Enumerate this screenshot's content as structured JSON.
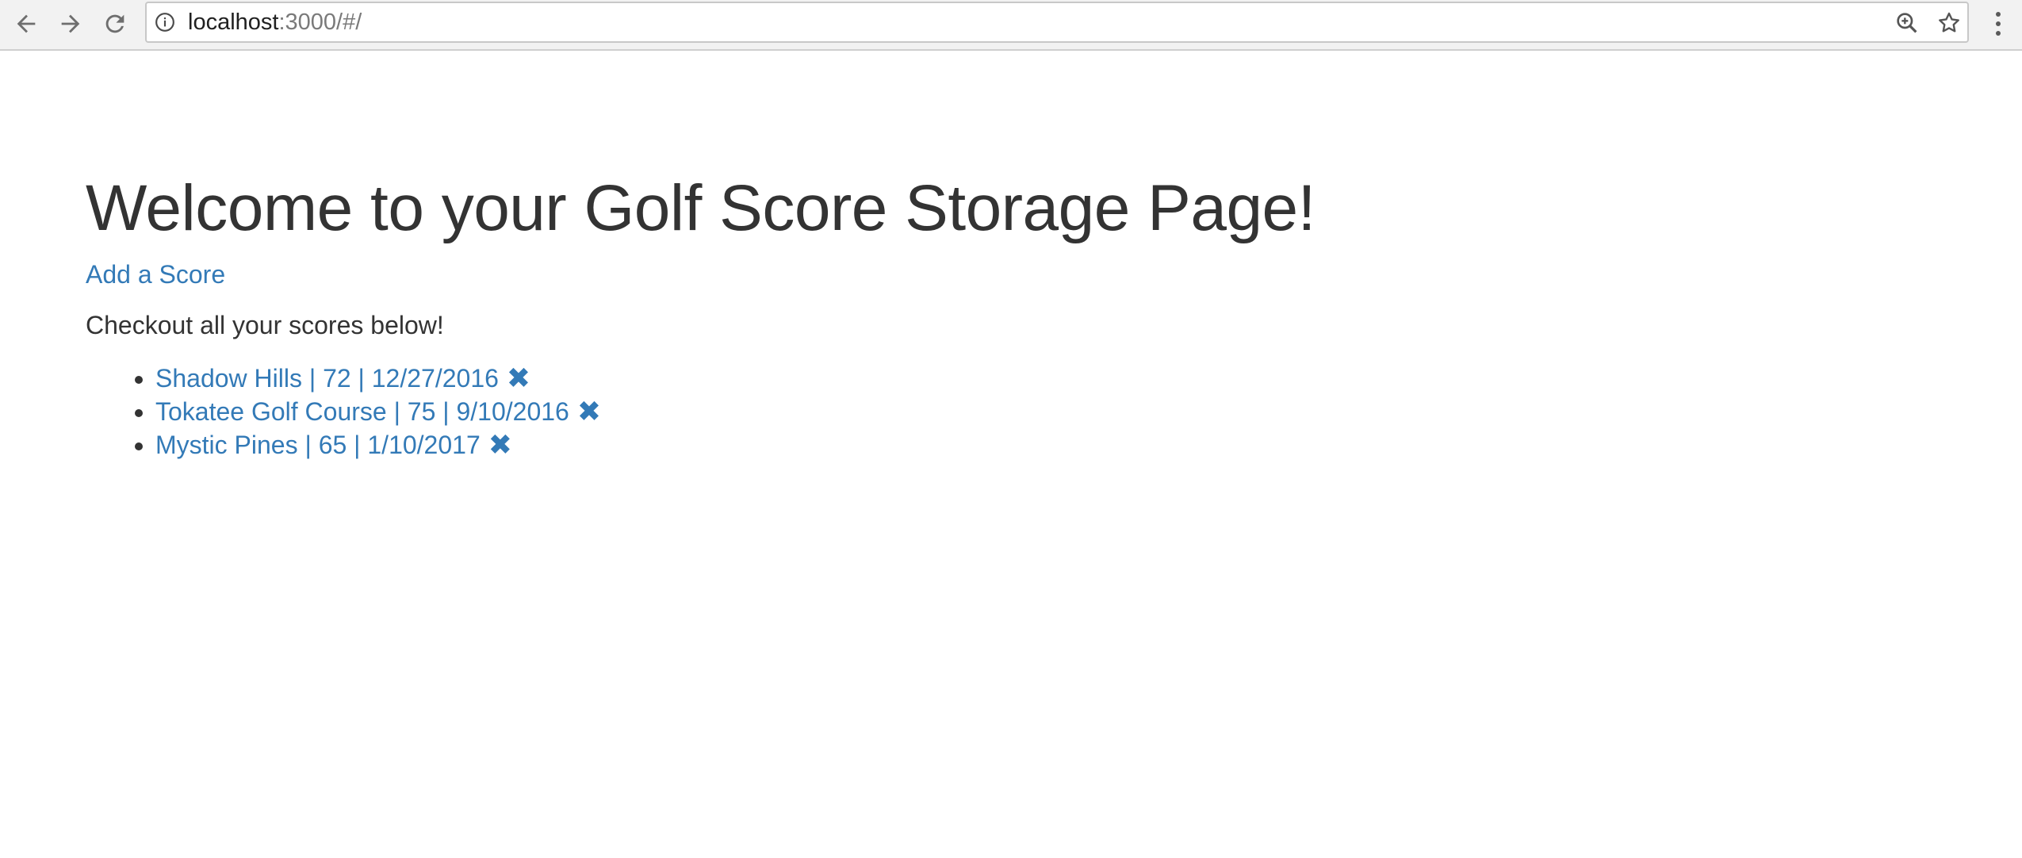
{
  "browser": {
    "url_host": "localhost",
    "url_rest": ":3000/#/"
  },
  "page": {
    "title": "Welcome to your Golf Score Storage Page!",
    "add_link": "Add a Score",
    "intro": "Checkout all your scores below!",
    "scores": [
      {
        "label": "Shadow Hills | 72 | 12/27/2016",
        "remove": "✖"
      },
      {
        "label": "Tokatee Golf Course | 75 | 9/10/2016",
        "remove": "✖"
      },
      {
        "label": "Mystic Pines | 65 | 1/10/2017",
        "remove": "✖"
      }
    ]
  },
  "colors": {
    "link": "#337ab7",
    "text": "#333333",
    "toolbar": "#f2f2f2"
  }
}
